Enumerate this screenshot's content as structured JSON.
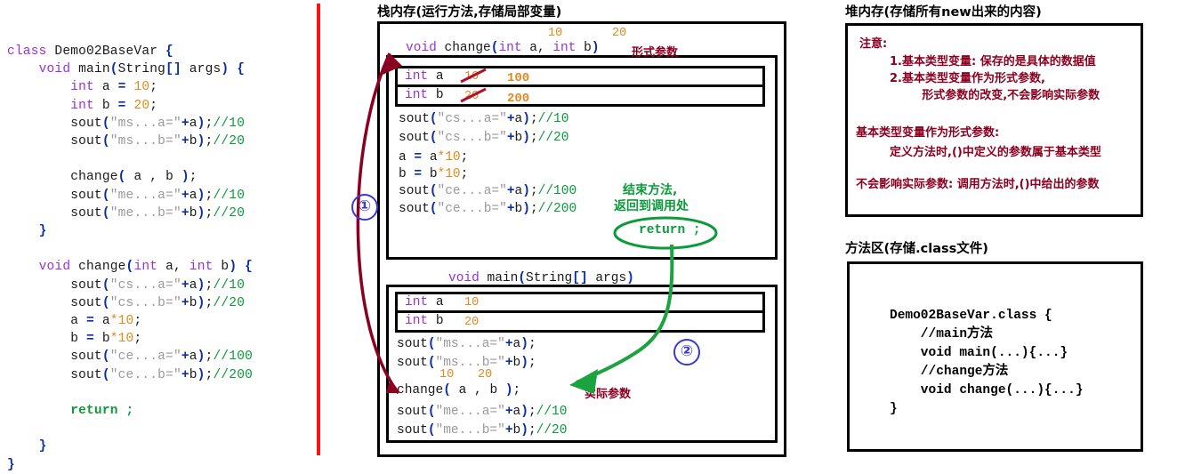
{
  "colors": {
    "divider_red": "#f01818",
    "dark_red": "#8b0020",
    "green": "#0b9b3a",
    "blue_circle": "#3a3ad0",
    "orange": "#e08a1e",
    "purple_keyword": "#9b30d9"
  },
  "source_code": {
    "lines": [
      "class Demo02BaseVar {",
      "    void main(String[] args) {",
      "        int a = 10;",
      "        int b = 20;",
      "        sout(\"ms...a=\"+a);//10",
      "        sout(\"ms...b=\"+b);//20",
      "",
      "        change( a , b );",
      "        sout(\"me...a=\"+a);//10",
      "        sout(\"me...b=\"+b);//20",
      "    }",
      "",
      "    void change(int a, int b) {",
      "        sout(\"cs...a=\"+a);//10",
      "        sout(\"cs...b=\"+b);//20",
      "        a = a*10;",
      "        b = b*10;",
      "        sout(\"ce...a=\"+a);//100",
      "        sout(\"ce...b=\"+b);//200",
      "",
      "        return ;",
      "",
      "    }",
      "}"
    ]
  },
  "stack": {
    "title": "栈内存(运行方法,存储局部变量)",
    "change_frame": {
      "signature": "void change(int a, int b)",
      "param_a_value": "10",
      "param_b_value": "20",
      "formal_param_label": "形式参数",
      "variables": [
        {
          "decl": "int a",
          "old_value": "10",
          "new_value": "100"
        },
        {
          "decl": "int b",
          "old_value": "20",
          "new_value": "200"
        }
      ],
      "body_lines": [
        "sout(\"cs...a=\"+a);//10",
        "sout(\"cs...b=\"+b);//20",
        "a = a*10;",
        "b = b*10;",
        "sout(\"ce...a=\"+a);//100",
        "sout(\"ce...b=\"+b);//200"
      ],
      "return_note_line1": "结束方法,",
      "return_note_line2": "返回到调用处",
      "return_bubble": "return ;"
    },
    "main_frame": {
      "signature": "void main(String[] args)",
      "variables": [
        {
          "decl": "int a",
          "value": "10"
        },
        {
          "decl": "int b",
          "value": "20"
        }
      ],
      "body_lines": [
        "sout(\"ms...a=\"+a);",
        "sout(\"ms...b=\"+b);"
      ],
      "call_line": "change( a , b );",
      "call_arg_a_value": "10",
      "call_arg_b_value": "20",
      "actual_param_label": "实际参数",
      "tail_lines": [
        "sout(\"me...a=\"+a);//10",
        "sout(\"me...b=\"+b);//20"
      ]
    },
    "marker_one": "①",
    "marker_two": "②"
  },
  "heap": {
    "title": "堆内存(存储所有new出来的内容)",
    "notice_heading": "注意:",
    "notice_items": [
      "1.基本类型变量: 保存的是具体的数据值",
      "2.基本类型变量作为形式参数,",
      "        形式参数的改变,不会影响实际参数"
    ],
    "definition_1_title": "基本类型变量作为形式参数:",
    "definition_1_body": "定义方法时,()中定义的参数属于基本类型",
    "definition_2": "不会影响实际参数: 调用方法时,()中给出的参数"
  },
  "method_area": {
    "title": "方法区(存储.class文件)",
    "code_lines": [
      "Demo02BaseVar.class {",
      "    //main方法",
      "    void main(...){...}",
      "    //change方法",
      "    void change(...){...}",
      "}"
    ]
  }
}
